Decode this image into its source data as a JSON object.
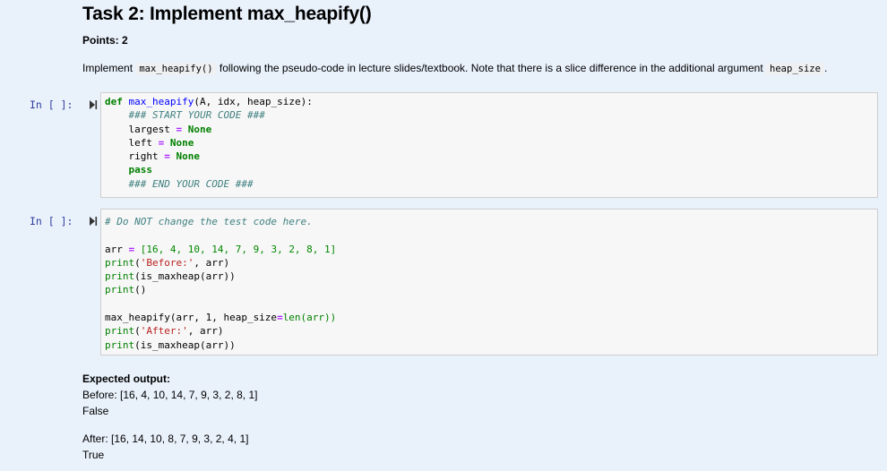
{
  "task": {
    "title": "Task 2: Implement max_heapify()",
    "points": "Points: 2",
    "desc_pre": "Implement ",
    "desc_code1": "max_heapify()",
    "desc_mid": " following the pseudo-code in lecture slides/textbook. Note that there is a slice difference in the additional argument ",
    "desc_code2": "heap_size",
    "desc_post": "."
  },
  "cell1": {
    "prompt": "In [ ]:",
    "def_kw": "def",
    "fn_name": "max_heapify",
    "signature": "(A, idx, heap_size):",
    "comment_start": "### START YOUR CODE ###",
    "var1": "largest",
    "var2": "left",
    "var3": "right",
    "none": "None",
    "eq": "=",
    "pass_kw": "pass",
    "comment_end": "### END YOUR CODE ###"
  },
  "cell2": {
    "prompt": "In [ ]:",
    "comment": "# Do NOT change the test code here.",
    "arr_line_pre": "arr ",
    "arr_values": "[16, 4, 10, 14, 7, 9, 3, 2, 8, 1]",
    "print": "print",
    "before_str": "'Before:'",
    "after_str": "'After:'",
    "args_arr": ", arr)",
    "is_maxheap": "(is_maxheap(arr))",
    "empty_call": "()",
    "heapify_pre": "max_heapify(arr, 1, heap_size",
    "heapify_post": "len(arr))"
  },
  "expected": {
    "label": "Expected output:",
    "before": "Before: [16, 4, 10, 14, 7, 9, 3, 2, 8, 1]",
    "false_val": "False",
    "after": "After: [16, 14, 10, 8, 7, 9, 3, 2, 4, 1]",
    "true_val": "True"
  }
}
